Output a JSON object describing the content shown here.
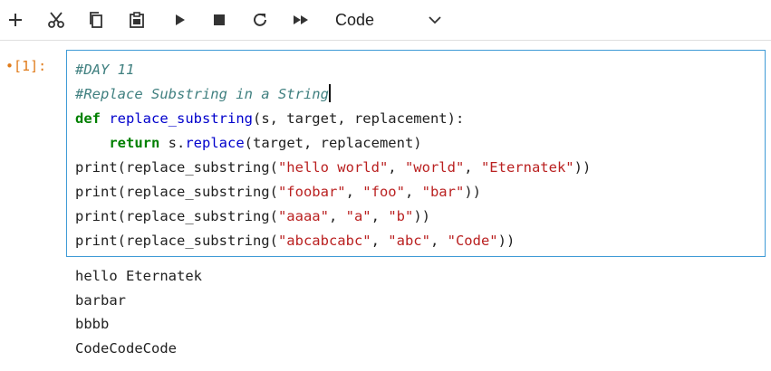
{
  "toolbar": {
    "icons": [
      "add-icon",
      "cut-icon",
      "copy-icon",
      "paste-icon",
      "run-icon",
      "stop-icon",
      "restart-icon",
      "fast-forward-icon"
    ],
    "cell_type": "Code"
  },
  "cell": {
    "prompt": "•[1]:",
    "code_lines": [
      [
        {
          "t": "#DAY 11",
          "c": "cm"
        }
      ],
      [
        {
          "t": "#Replace Substring in a String",
          "c": "cm"
        },
        {
          "t": "",
          "c": "cursor"
        }
      ],
      [
        {
          "t": "def",
          "c": "kw"
        },
        {
          "t": " ",
          "c": ""
        },
        {
          "t": "replace_substring",
          "c": "fn"
        },
        {
          "t": "(s, target, replacement):",
          "c": ""
        }
      ],
      [
        {
          "t": "    ",
          "c": ""
        },
        {
          "t": "return",
          "c": "kw"
        },
        {
          "t": " s.",
          "c": ""
        },
        {
          "t": "replace",
          "c": "fn"
        },
        {
          "t": "(target, replacement)",
          "c": ""
        }
      ],
      [
        {
          "t": "print(replace_substring(",
          "c": ""
        },
        {
          "t": "\"hello world\"",
          "c": "st"
        },
        {
          "t": ", ",
          "c": ""
        },
        {
          "t": "\"world\"",
          "c": "st"
        },
        {
          "t": ", ",
          "c": ""
        },
        {
          "t": "\"Eternatek\"",
          "c": "st"
        },
        {
          "t": "))",
          "c": ""
        }
      ],
      [
        {
          "t": "print(replace_substring(",
          "c": ""
        },
        {
          "t": "\"foobar\"",
          "c": "st"
        },
        {
          "t": ", ",
          "c": ""
        },
        {
          "t": "\"foo\"",
          "c": "st"
        },
        {
          "t": ", ",
          "c": ""
        },
        {
          "t": "\"bar\"",
          "c": "st"
        },
        {
          "t": "))",
          "c": ""
        }
      ],
      [
        {
          "t": "print(replace_substring(",
          "c": ""
        },
        {
          "t": "\"aaaa\"",
          "c": "st"
        },
        {
          "t": ", ",
          "c": ""
        },
        {
          "t": "\"a\"",
          "c": "st"
        },
        {
          "t": ", ",
          "c": ""
        },
        {
          "t": "\"b\"",
          "c": "st"
        },
        {
          "t": "))",
          "c": ""
        }
      ],
      [
        {
          "t": "print(replace_substring(",
          "c": ""
        },
        {
          "t": "\"abcabcabc\"",
          "c": "st"
        },
        {
          "t": ", ",
          "c": ""
        },
        {
          "t": "\"abc\"",
          "c": "st"
        },
        {
          "t": ", ",
          "c": ""
        },
        {
          "t": "\"Code\"",
          "c": "st"
        },
        {
          "t": "))",
          "c": ""
        }
      ]
    ],
    "output_lines": [
      "hello Eternatek",
      "barbar",
      "bbbb",
      "CodeCodeCode"
    ]
  },
  "colors": {
    "comment": "#408080",
    "keyword": "#008000",
    "function": "#0000cc",
    "string": "#ba2121",
    "prompt": "#e07b1a",
    "editor_border": "#3f9bd6"
  }
}
